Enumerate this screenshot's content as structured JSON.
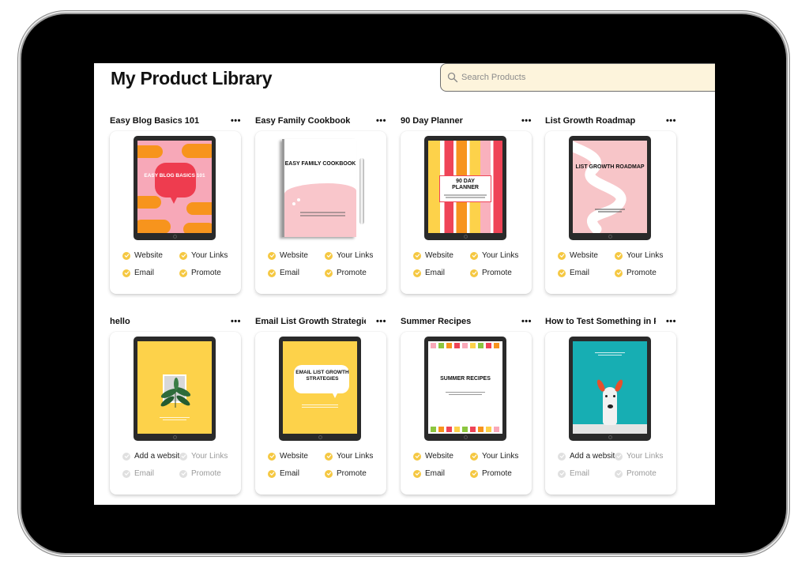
{
  "page": {
    "title": "My Product Library",
    "search_placeholder": "Search Products"
  },
  "colors": {
    "check_active": "#f5c842",
    "check_inactive": "#e0e0e0",
    "search_bg": "#fdf4dc"
  },
  "products": [
    {
      "title": "Easy Blog Basics 101",
      "cover_text": "EASY BLOG BASICS 101",
      "cover_style": "blog",
      "checks": [
        {
          "label": "Website",
          "done": true
        },
        {
          "label": "Your Links",
          "done": true
        },
        {
          "label": "Email",
          "done": true
        },
        {
          "label": "Promote",
          "done": true
        }
      ]
    },
    {
      "title": "Easy Family Cookbook",
      "cover_text": "EASY FAMILY COOKBOOK",
      "cover_style": "cookbook",
      "checks": [
        {
          "label": "Website",
          "done": true
        },
        {
          "label": "Your Links",
          "done": true
        },
        {
          "label": "Email",
          "done": true
        },
        {
          "label": "Promote",
          "done": true
        }
      ]
    },
    {
      "title": "90 Day Planner",
      "cover_text": "90 DAY PLANNER",
      "cover_style": "planner",
      "checks": [
        {
          "label": "Website",
          "done": true
        },
        {
          "label": "Your Links",
          "done": true
        },
        {
          "label": "Email",
          "done": true
        },
        {
          "label": "Promote",
          "done": true
        }
      ]
    },
    {
      "title": "List Growth Roadmap",
      "cover_text": "LIST GROWTH ROADMAP",
      "cover_style": "roadmap",
      "checks": [
        {
          "label": "Website",
          "done": true
        },
        {
          "label": "Your Links",
          "done": true
        },
        {
          "label": "Email",
          "done": true
        },
        {
          "label": "Promote",
          "done": true
        }
      ]
    },
    {
      "title": "hello",
      "cover_text": "",
      "cover_style": "plant",
      "checks": [
        {
          "label": "Add a website",
          "done": false,
          "emphasis": true
        },
        {
          "label": "Your Links",
          "done": false
        },
        {
          "label": "Email",
          "done": false
        },
        {
          "label": "Promote",
          "done": false
        }
      ]
    },
    {
      "title": "Email List Growth Strategies",
      "cover_text": "EMAIL LIST GROWTH STRATEGIES",
      "cover_style": "emaillist",
      "checks": [
        {
          "label": "Website",
          "done": true
        },
        {
          "label": "Your Links",
          "done": true
        },
        {
          "label": "Email",
          "done": true
        },
        {
          "label": "Promote",
          "done": true
        }
      ]
    },
    {
      "title": "Summer Recipes",
      "cover_text": "SUMMER RECIPES",
      "cover_style": "summer",
      "checks": [
        {
          "label": "Website",
          "done": true
        },
        {
          "label": "Your Links",
          "done": true
        },
        {
          "label": "Email",
          "done": true
        },
        {
          "label": "Promote",
          "done": true
        }
      ]
    },
    {
      "title": "How to Test Something in P...",
      "cover_text": "",
      "cover_style": "dog",
      "checks": [
        {
          "label": "Add a website",
          "done": false,
          "emphasis": true
        },
        {
          "label": "Your Links",
          "done": false
        },
        {
          "label": "Email",
          "done": false
        },
        {
          "label": "Promote",
          "done": false
        }
      ]
    }
  ],
  "more_label": "•••"
}
